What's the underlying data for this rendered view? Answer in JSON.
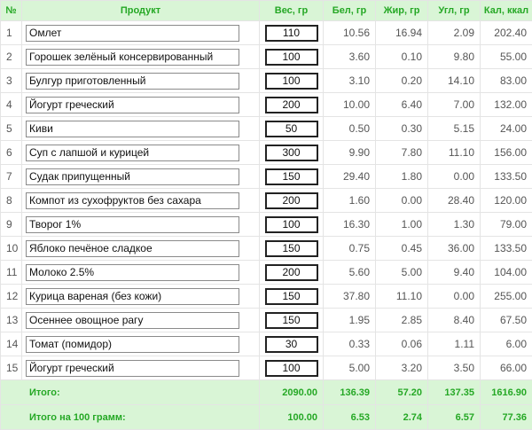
{
  "header": {
    "num": "№",
    "product": "Продукт",
    "weight": "Вес, гр",
    "protein": "Бел, гр",
    "fat": "Жир, гр",
    "carbs": "Угл, гр",
    "kcal": "Кал, ккал"
  },
  "rows": [
    {
      "num": "1",
      "product": "Омлет",
      "weight": "110",
      "protein": "10.56",
      "fat": "16.94",
      "carbs": "2.09",
      "kcal": "202.40"
    },
    {
      "num": "2",
      "product": "Горошек зелёный консервированный",
      "weight": "100",
      "protein": "3.60",
      "fat": "0.10",
      "carbs": "9.80",
      "kcal": "55.00"
    },
    {
      "num": "3",
      "product": "Булгур приготовленный",
      "weight": "100",
      "protein": "3.10",
      "fat": "0.20",
      "carbs": "14.10",
      "kcal": "83.00"
    },
    {
      "num": "4",
      "product": "Йогурт греческий",
      "weight": "200",
      "protein": "10.00",
      "fat": "6.40",
      "carbs": "7.00",
      "kcal": "132.00"
    },
    {
      "num": "5",
      "product": "Киви",
      "weight": "50",
      "protein": "0.50",
      "fat": "0.30",
      "carbs": "5.15",
      "kcal": "24.00"
    },
    {
      "num": "6",
      "product": "Суп с лапшой и курицей",
      "weight": "300",
      "protein": "9.90",
      "fat": "7.80",
      "carbs": "11.10",
      "kcal": "156.00"
    },
    {
      "num": "7",
      "product": "Судак припущенный",
      "weight": "150",
      "protein": "29.40",
      "fat": "1.80",
      "carbs": "0.00",
      "kcal": "133.50"
    },
    {
      "num": "8",
      "product": "Компот из сухофруктов без сахара",
      "weight": "200",
      "protein": "1.60",
      "fat": "0.00",
      "carbs": "28.40",
      "kcal": "120.00"
    },
    {
      "num": "9",
      "product": "Творог 1%",
      "weight": "100",
      "protein": "16.30",
      "fat": "1.00",
      "carbs": "1.30",
      "kcal": "79.00"
    },
    {
      "num": "10",
      "product": "Яблоко печёное сладкое",
      "weight": "150",
      "protein": "0.75",
      "fat": "0.45",
      "carbs": "36.00",
      "kcal": "133.50"
    },
    {
      "num": "11",
      "product": "Молоко 2.5%",
      "weight": "200",
      "protein": "5.60",
      "fat": "5.00",
      "carbs": "9.40",
      "kcal": "104.00"
    },
    {
      "num": "12",
      "product": "Курица вареная (без кожи)",
      "weight": "150",
      "protein": "37.80",
      "fat": "11.10",
      "carbs": "0.00",
      "kcal": "255.00"
    },
    {
      "num": "13",
      "product": "Осеннее овощное рагу",
      "weight": "150",
      "protein": "1.95",
      "fat": "2.85",
      "carbs": "8.40",
      "kcal": "67.50"
    },
    {
      "num": "14",
      "product": "Томат (помидор)",
      "weight": "30",
      "protein": "0.33",
      "fat": "0.06",
      "carbs": "1.11",
      "kcal": "6.00"
    },
    {
      "num": "15",
      "product": "Йогурт греческий",
      "weight": "100",
      "protein": "5.00",
      "fat": "3.20",
      "carbs": "3.50",
      "kcal": "66.00"
    }
  ],
  "totals": {
    "label": "Итого:",
    "weight": "2090.00",
    "protein": "136.39",
    "fat": "57.20",
    "carbs": "137.35",
    "kcal": "1616.90"
  },
  "per100": {
    "label": "Итого на 100 грамм:",
    "weight": "100.00",
    "protein": "6.53",
    "fat": "2.74",
    "carbs": "6.57",
    "kcal": "77.36"
  },
  "colors": {
    "accent_green": "#25a825",
    "header_bg": "#d9f5d6"
  }
}
